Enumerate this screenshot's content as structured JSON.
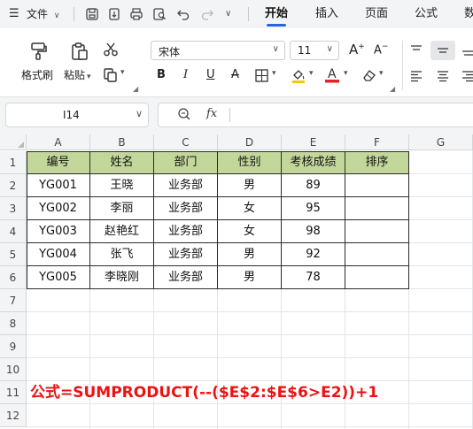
{
  "menubar": {
    "file_label": "文件",
    "tabs": [
      "开始",
      "插入",
      "页面",
      "公式",
      "数"
    ],
    "active_tab": "开始"
  },
  "ribbon": {
    "format_painter_label": "格式刷",
    "paste_label": "粘贴",
    "font_name": "宋体",
    "font_size": "11",
    "font_color": "#e0242a",
    "fill_color": "#f3c617"
  },
  "formula_bar": {
    "cell_ref": "I14",
    "fx_label": "fx",
    "formula": ""
  },
  "sheet": {
    "columns": [
      "A",
      "B",
      "C",
      "D",
      "E",
      "F",
      "G"
    ],
    "rows": [
      "1",
      "2",
      "3",
      "4",
      "5",
      "6",
      "7",
      "8",
      "9",
      "10",
      "11",
      "12"
    ],
    "header_fill": "#c4d79b",
    "headers": [
      "编号",
      "姓名",
      "部门",
      "性别",
      "考核成绩",
      "排序"
    ],
    "data": [
      [
        "YG001",
        "王晓",
        "业务部",
        "男",
        "89",
        ""
      ],
      [
        "YG002",
        "李丽",
        "业务部",
        "女",
        "95",
        ""
      ],
      [
        "YG003",
        "赵艳红",
        "业务部",
        "女",
        "98",
        ""
      ],
      [
        "YG004",
        "张飞",
        "业务部",
        "男",
        "92",
        ""
      ],
      [
        "YG005",
        "李晓刚",
        "业务部",
        "男",
        "78",
        ""
      ]
    ],
    "note": "公式=SUMPRODUCT(--($E$2:$E$6>E2))+1",
    "note_color": "#ee1111"
  }
}
